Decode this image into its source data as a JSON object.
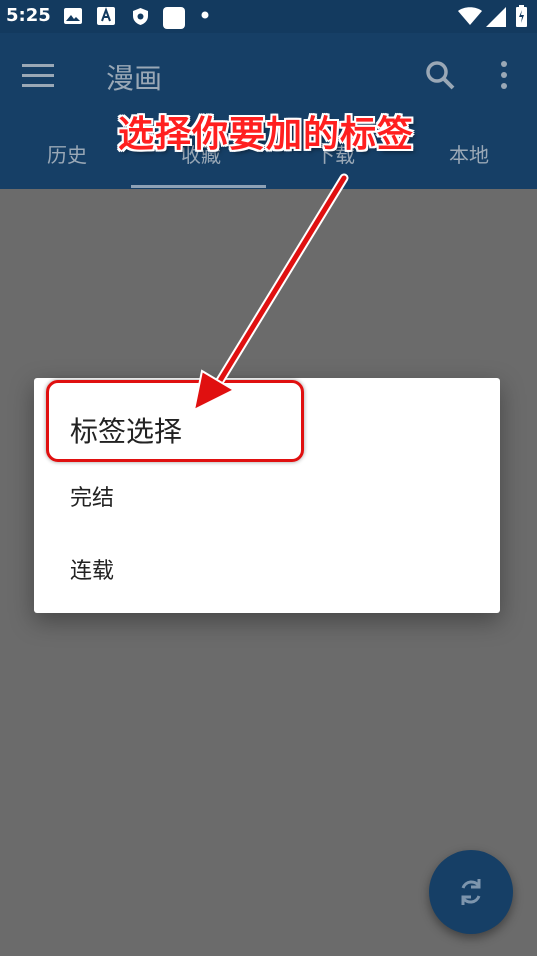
{
  "status_bar": {
    "time": "5:25",
    "icons": [
      "image-icon",
      "font-app-icon",
      "shield-icon",
      "square-app-icon",
      "notification-dot-icon",
      "wifi-icon",
      "signal-icon",
      "battery-charging-icon"
    ]
  },
  "app_bar": {
    "title": "漫画",
    "menu_icon": "menu-icon",
    "search_icon": "search-icon",
    "more_icon": "more-vert-icon",
    "accent_color": "#163f66"
  },
  "tabs": [
    {
      "label": "历史"
    },
    {
      "label": "收藏"
    },
    {
      "label": "下载"
    },
    {
      "label": "本地"
    }
  ],
  "selected_tab": "收藏",
  "annotation": {
    "text": "选择你要加的标签",
    "color": "#ff1f1f"
  },
  "dialog": {
    "title": "标签选择",
    "options": [
      {
        "label": "完结"
      },
      {
        "label": "连载"
      }
    ]
  },
  "fab": {
    "icon": "refresh-icon"
  }
}
